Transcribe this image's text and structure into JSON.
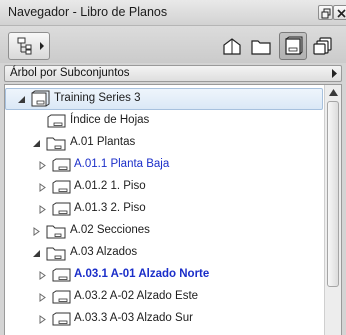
{
  "window": {
    "title": "Navegador - Libro de Planos"
  },
  "toolbar": {
    "menu_icon": "tree-options-icon",
    "maps": [
      {
        "name": "project-map",
        "icon": "house-icon",
        "active": false
      },
      {
        "name": "view-map",
        "icon": "folder-icon",
        "active": false
      },
      {
        "name": "layout-book",
        "icon": "layout-book-icon",
        "active": true
      },
      {
        "name": "publisher-sets",
        "icon": "publisher-sets-icon",
        "active": false
      }
    ]
  },
  "subset_selector": {
    "label": "Árbol por Subconjuntos"
  },
  "tree": {
    "items": [
      {
        "label": "Training Series 3",
        "level": 0,
        "type": "book",
        "expander": "expanded",
        "selected": true
      },
      {
        "label": "Índice de Hojas",
        "level": 1,
        "type": "layout",
        "expander": "none"
      },
      {
        "label": "A.01 Plantas",
        "level": 1,
        "type": "subset",
        "expander": "expanded"
      },
      {
        "label": "A.01.1 Planta Baja",
        "level": 2,
        "type": "layout",
        "expander": "collapsed",
        "color": "#1b2ec9"
      },
      {
        "label": "A.01.2 1. Piso",
        "level": 2,
        "type": "layout",
        "expander": "collapsed"
      },
      {
        "label": "A.01.3 2. Piso",
        "level": 2,
        "type": "layout",
        "expander": "collapsed"
      },
      {
        "label": "A.02 Secciones",
        "level": 1,
        "type": "subset",
        "expander": "collapsed"
      },
      {
        "label": "A.03 Alzados",
        "level": 1,
        "type": "subset",
        "expander": "expanded"
      },
      {
        "label": "A.03.1 A-01 Alzado Norte",
        "level": 2,
        "type": "layout",
        "expander": "collapsed",
        "color": "#1b2ec9",
        "bold": true
      },
      {
        "label": "A.03.2 A-02 Alzado Este",
        "level": 2,
        "type": "layout",
        "expander": "collapsed"
      },
      {
        "label": "A.03.3 A-03 Alzado Sur",
        "level": 2,
        "type": "layout",
        "expander": "collapsed"
      }
    ]
  }
}
